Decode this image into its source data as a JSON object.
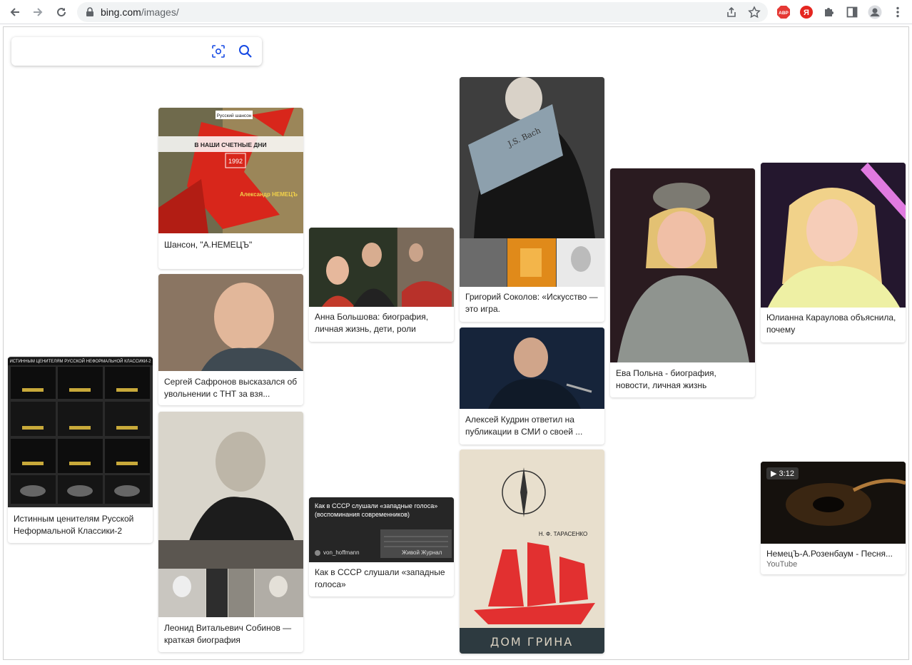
{
  "browser": {
    "url_host": "bing.com",
    "url_path": "/images/",
    "extensions": [
      "ABP",
      "Я"
    ]
  },
  "search": {
    "value": ""
  },
  "cards": [
    {
      "caption": "Истинным ценителям Русской Неформальной Классики-2",
      "image_text": "ИСТИННЫМ ЦЕНИТЕЛЯМ РУССКОЙ НЕФОРМАЛЬНОЙ КЛАССИКИ-2"
    },
    {
      "caption": "Шансон, \"А.НЕМЕЦЪ\"",
      "image_text": [
        "Русский шансон",
        "В НАШИ СЧЕТНЫЕ ДНИ",
        "1992",
        "Александр НЕМЕЦЪ"
      ]
    },
    {
      "caption": "Сергей Сафронов высказался об увольнении с ТНТ за взя..."
    },
    {
      "caption": "Леонид Витальевич Собинов — краткая биография"
    },
    {
      "caption": "Анна Большова: биография, личная жизнь, дети, роли"
    },
    {
      "caption": "Как в СССР слушали «западные голоса»",
      "image_text": [
        "Как в СССР слушали «западные голоса» (воспоминания современников)",
        "von_hoffmann",
        "Живой Журнал"
      ]
    },
    {
      "caption": "Григорий Соколов: «Искусство — это игра.",
      "image_text": "J.S. Bach"
    },
    {
      "caption": "Алексей Кудрин ответил на публикации в СМИ о своей ..."
    },
    {
      "caption": "",
      "image_text": [
        "Н. Ф. ТАРАСЕНКО",
        "ДОМ ГРИНА"
      ]
    },
    {
      "caption": "Ева Польна - биография, новости, личная жизнь"
    },
    {
      "caption": "Юлианна Караулова объяснила, почему"
    },
    {
      "caption": "НемецЪ-А.Розенбаум - Песня...",
      "source": "YouTube",
      "duration": "3:12"
    }
  ],
  "colors": {
    "accent": "#174ae4",
    "abp": "#e53935",
    "yandex": "#e52620"
  }
}
